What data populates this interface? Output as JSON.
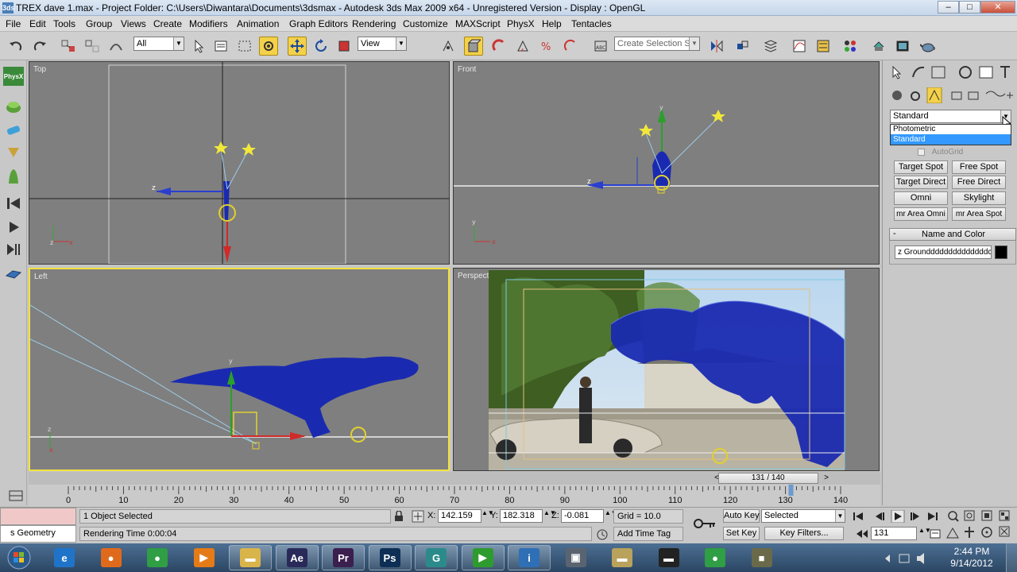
{
  "window": {
    "title": "TREX dave 1.max    - Project Folder: C:\\Users\\Diwantara\\Documents\\3dsmax    - Autodesk 3ds Max  2009 x64    - Unregistered Version    - Display : OpenGL",
    "app_icon": "3ds",
    "minimize": "–",
    "maximize": "□",
    "close": "✕"
  },
  "menu": [
    "File",
    "Edit",
    "Tools",
    "Group",
    "Views",
    "Create",
    "Modifiers",
    "Animation",
    "Graph Editors",
    "Rendering",
    "Customize",
    "MAXScript",
    "PhysX",
    "Help",
    "Tentacles"
  ],
  "toolbar": {
    "selection_filter": "All",
    "reference_coord": "View",
    "named_selection_placeholder": "Create Selection Set"
  },
  "viewports": {
    "top": {
      "label": "Top"
    },
    "front": {
      "label": "Front"
    },
    "left": {
      "label": "Left"
    },
    "perspective": {
      "label": "Perspective"
    }
  },
  "command_panel": {
    "category_dropdown": "Standard",
    "dropdown_options": [
      "Photometric",
      "Standard"
    ],
    "autogrid_label": "AutoGrid",
    "object_buttons": [
      "Target Spot",
      "Free Spot",
      "Target Direct",
      "Free Direct",
      "Omni",
      "Skylight",
      "mr Area Omni",
      "mr Area Spot"
    ],
    "rollout_title": "Name and Color",
    "rollout_toggle": "-",
    "object_name": "z Grounddddddddddddddc",
    "object_color": "#000000"
  },
  "timeline": {
    "frame_counter": "131 / 140",
    "current_frame": 131,
    "total_frames": 140,
    "ticks": [
      "0",
      "10",
      "20",
      "30",
      "40",
      "50",
      "60",
      "70",
      "80",
      "90",
      "100",
      "110",
      "120",
      "130",
      "140"
    ]
  },
  "status": {
    "objects_selected": "1 Object Selected",
    "prompt": "Rendering Time  0:00:04",
    "listener_label": "s Geometry",
    "x_label": "X:",
    "x_value": "142.159",
    "y_label": "Y:",
    "y_value": "182.318",
    "z_label": "Z:",
    "z_value": "-0.081",
    "grid": "Grid = 10.0",
    "add_time_tag": "Add Time Tag",
    "auto_key": "Auto Key",
    "set_key": "Set Key",
    "key_mode": "Selected",
    "key_filters": "Key Filters...",
    "frame_field": "131"
  },
  "taskbar": {
    "clock_time": "2:44 PM",
    "clock_date": "9/14/2012",
    "apps": [
      {
        "name": "ie-icon",
        "glyph": "e",
        "color": "#1f74c9"
      },
      {
        "name": "firefox-icon",
        "glyph": "●",
        "color": "#e06a1b"
      },
      {
        "name": "chrome-icon",
        "glyph": "●",
        "color": "#2f9e44"
      },
      {
        "name": "media-player-icon",
        "glyph": "▶",
        "color": "#e57b17"
      },
      {
        "name": "explorer-icon",
        "glyph": "▬",
        "color": "#d9b44a"
      },
      {
        "name": "after-effects-icon",
        "glyph": "Ae",
        "color": "#2a2a5a"
      },
      {
        "name": "premiere-icon",
        "glyph": "Pr",
        "color": "#3b1f4f"
      },
      {
        "name": "photoshop-icon",
        "glyph": "Ps",
        "color": "#0e2f55"
      },
      {
        "name": "3dsmax-icon",
        "glyph": "G",
        "color": "#2b8b8b"
      },
      {
        "name": "video-player-icon",
        "glyph": "▶",
        "color": "#2e9b2e"
      },
      {
        "name": "info-icon",
        "glyph": "i",
        "color": "#2f6fb5"
      },
      {
        "name": "network-icon",
        "glyph": "▣",
        "color": "#5a6470"
      },
      {
        "name": "folder-icon",
        "glyph": "▬",
        "color": "#b9a25c"
      },
      {
        "name": "chat-icon",
        "glyph": "▬",
        "color": "#222"
      },
      {
        "name": "chrome2-icon",
        "glyph": "●",
        "color": "#2f9e44"
      },
      {
        "name": "tool-icon",
        "glyph": "■",
        "color": "#6a6a4a"
      }
    ]
  }
}
